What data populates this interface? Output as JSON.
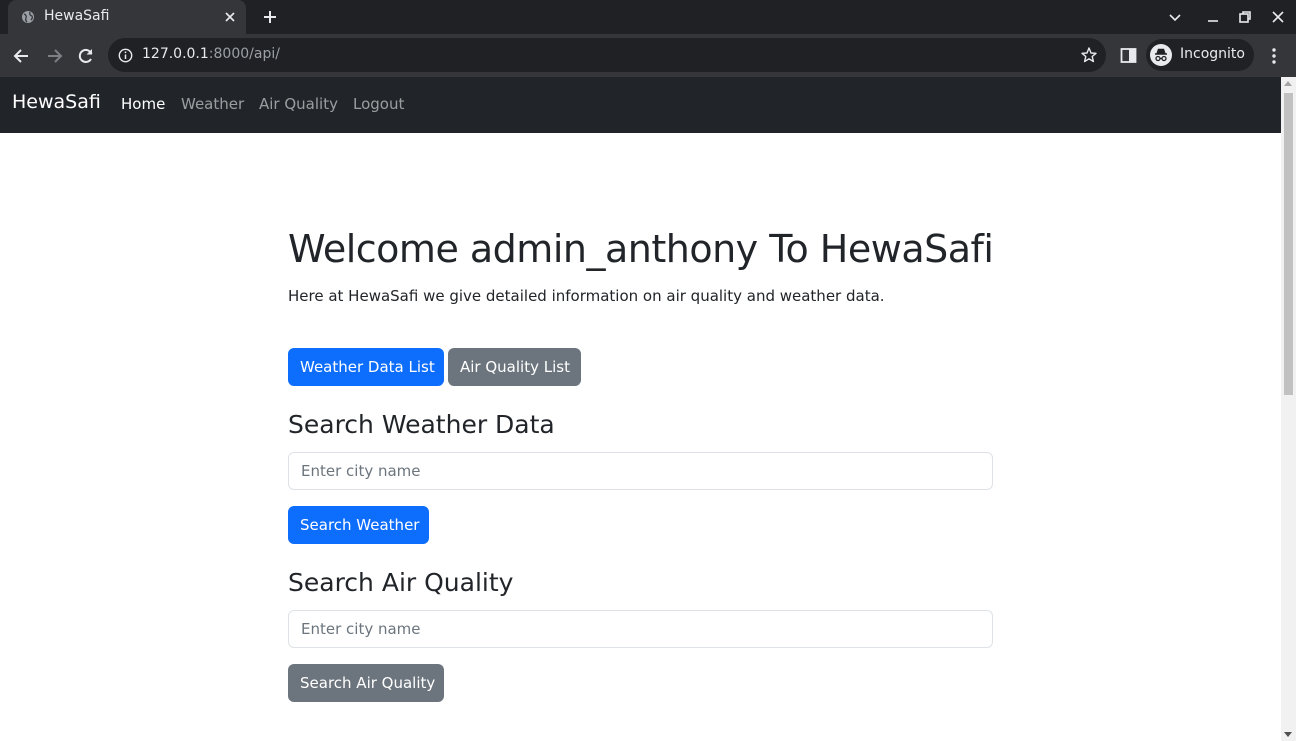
{
  "browser": {
    "tab_title": "HewaSafi",
    "url_host": "127.0.0.1",
    "url_path": ":8000/api/",
    "profile_label": "Incognito"
  },
  "navbar": {
    "brand": "HewaSafi",
    "links": [
      "Home",
      "Weather",
      "Air Quality",
      "Logout"
    ],
    "active": "Home"
  },
  "hero": {
    "title": "Welcome admin_anthony To HewaSafi",
    "intro": "Here at HewaSafi we give detailed information on air quality and weather data."
  },
  "actions": {
    "weather_list": "Weather Data List",
    "air_list": "Air Quality List"
  },
  "weather_search": {
    "heading": "Search Weather Data",
    "placeholder": "Enter city name",
    "button": "Search Weather"
  },
  "air_search": {
    "heading": "Search Air Quality",
    "placeholder": "Enter city name",
    "button": "Search Air Quality"
  },
  "colors": {
    "primary": "#0d6efd",
    "secondary": "#6c757d",
    "navbar": "#212529"
  }
}
